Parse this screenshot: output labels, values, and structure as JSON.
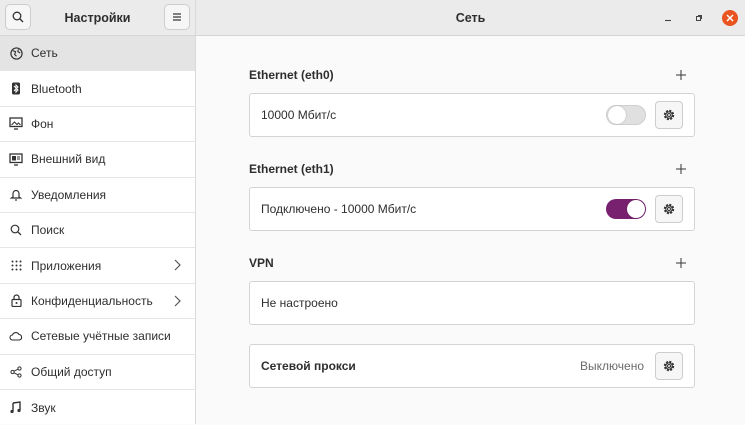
{
  "window": {
    "sidebar_title": "Настройки",
    "page_title": "Сеть"
  },
  "sidebar": {
    "items": [
      {
        "label": "Сеть",
        "icon": "globe-icon",
        "active": true,
        "chevron": false
      },
      {
        "label": "Bluetooth",
        "icon": "bluetooth-icon",
        "active": false,
        "chevron": false
      },
      {
        "label": "Фон",
        "icon": "background-icon",
        "active": false,
        "chevron": false
      },
      {
        "label": "Внешний вид",
        "icon": "appearance-icon",
        "active": false,
        "chevron": false
      },
      {
        "label": "Уведомления",
        "icon": "bell-icon",
        "active": false,
        "chevron": false
      },
      {
        "label": "Поиск",
        "icon": "search-icon",
        "active": false,
        "chevron": false
      },
      {
        "label": "Приложения",
        "icon": "apps-grid-icon",
        "active": false,
        "chevron": true
      },
      {
        "label": "Конфиденциальность",
        "icon": "lock-icon",
        "active": false,
        "chevron": true
      },
      {
        "label": "Сетевые учётные записи",
        "icon": "cloud-icon",
        "active": false,
        "chevron": false
      },
      {
        "label": "Общий доступ",
        "icon": "share-icon",
        "active": false,
        "chevron": false
      },
      {
        "label": "Звук",
        "icon": "music-note-icon",
        "active": false,
        "chevron": false
      }
    ]
  },
  "sections": {
    "eth0": {
      "heading": "Ethernet (eth0)",
      "status": "10000 Мбит/с",
      "enabled": false
    },
    "eth1": {
      "heading": "Ethernet (eth1)",
      "status": "Подключено - 10000 Мбит/с",
      "enabled": true
    },
    "vpn": {
      "heading": "VPN",
      "status": "Не настроено"
    },
    "proxy": {
      "label": "Сетевой прокси",
      "status": "Выключено"
    }
  },
  "colors": {
    "accent_toggle": "#77216f",
    "close_button": "#e95420"
  }
}
